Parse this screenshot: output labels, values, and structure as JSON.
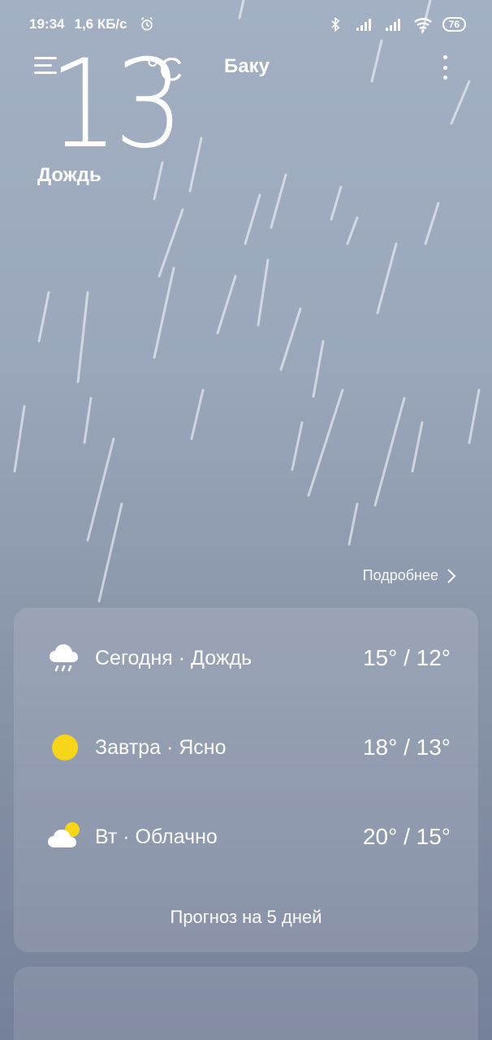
{
  "status_bar": {
    "time": "19:34",
    "net_speed": "1,6 КБ/с",
    "battery": "76"
  },
  "weather": {
    "temperature": "13",
    "unit": "°C",
    "city": "Баку",
    "condition": "Дождь",
    "details_label": "Подробнее"
  },
  "forecast": {
    "days": [
      {
        "label": "Сегодня · Дождь",
        "temps": "15° / 12°",
        "icon": "rain-cloud-icon"
      },
      {
        "label": "Завтра · Ясно",
        "temps": "18° / 13°",
        "icon": "sun-icon"
      },
      {
        "label": "Вт · Облачно",
        "temps": "20° / 15°",
        "icon": "partly-cloudy-icon"
      }
    ],
    "five_day_label": "Прогноз на 5 дней"
  },
  "colors": {
    "sun": "#f7d61a",
    "background_top": "#a3b0c4",
    "background_bottom": "#75809a"
  }
}
